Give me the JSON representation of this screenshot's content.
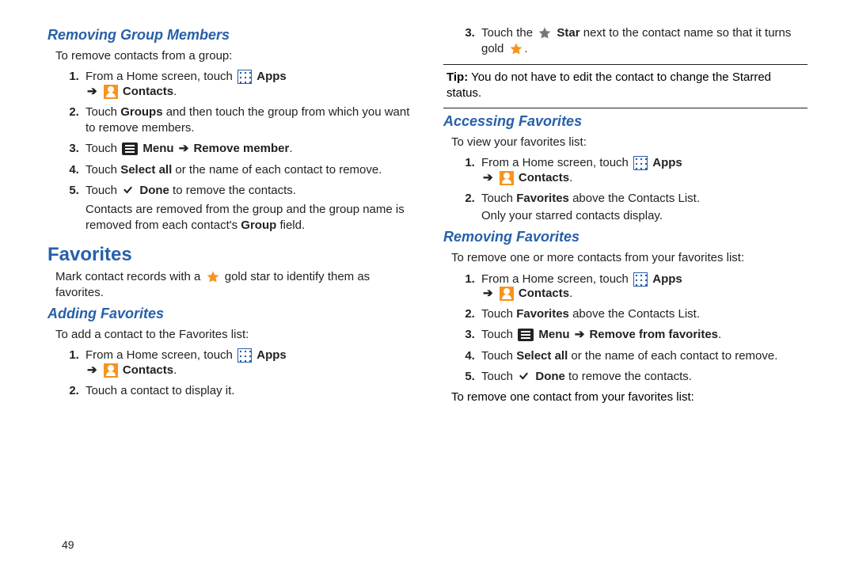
{
  "page_number": "49",
  "left": {
    "h_removing_group": "Removing Group Members",
    "removing_group_intro": "To remove contacts from a group:",
    "removing_group_steps": {
      "s1_a": "From a Home screen, touch ",
      "s1_apps": "Apps",
      "s1_b": "Contacts",
      "s2_a": "Touch ",
      "s2_b": "Groups",
      "s2_c": " and then touch the group from which you want to remove members.",
      "s3_a": "Touch ",
      "s3_b": "Menu",
      "s3_c": "Remove member",
      "s4_a": "Touch ",
      "s4_b": "Select all",
      "s4_c": " or the name of each contact to remove.",
      "s5_a": "Touch ",
      "s5_b": "Done",
      "s5_c": " to remove the contacts.",
      "s5_note": "Contacts are removed from the group and the group name is removed from each contact's ",
      "s5_note_b": "Group",
      "s5_note_c": " field."
    },
    "h_favorites": "Favorites",
    "favorites_intro_a": "Mark contact records with a ",
    "favorites_intro_b": " gold star to identify them as favorites.",
    "h_adding": "Adding Favorites",
    "adding_intro": "To add a contact to the Favorites list:",
    "adding_steps": {
      "s1_a": "From a Home screen, touch ",
      "s1_apps": "Apps",
      "s1_b": "Contacts",
      "s2": "Touch a contact to display it."
    }
  },
  "right": {
    "s3_a": "Touch the ",
    "s3_b": "Star",
    "s3_c": " next to the contact name so that it turns gold ",
    "tip_a": "Tip:",
    "tip_b": " You do not have to edit the contact to change the Starred status.",
    "h_accessing": "Accessing Favorites",
    "accessing_intro": "To view your favorites list:",
    "accessing_steps": {
      "s1_a": "From a Home screen, touch ",
      "s1_apps": "Apps",
      "s1_b": "Contacts",
      "s2_a": "Touch ",
      "s2_b": "Favorites",
      "s2_c": " above the Contacts List.",
      "s2_note": "Only your starred contacts display."
    },
    "h_removing": "Removing Favorites",
    "removing_intro": "To remove one or more contacts from your favorites list:",
    "removing_steps": {
      "s1_a": "From a Home screen, touch ",
      "s1_apps": "Apps",
      "s1_b": "Contacts",
      "s2_a": "Touch ",
      "s2_b": "Favorites",
      "s2_c": " above the Contacts List.",
      "s3_a": "Touch ",
      "s3_b": "Menu",
      "s3_c": "Remove from favorites",
      "s4_a": "Touch ",
      "s4_b": "Select all",
      "s4_c": " or the name of each contact to remove.",
      "s5_a": "Touch ",
      "s5_b": "Done",
      "s5_c": " to remove the contacts."
    },
    "removing_after": "To remove one contact from your favorites list:"
  }
}
